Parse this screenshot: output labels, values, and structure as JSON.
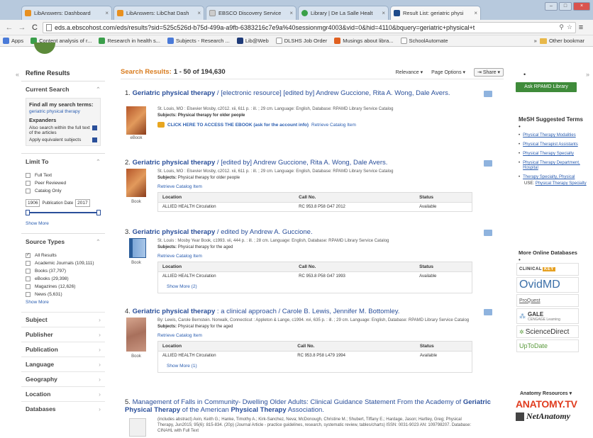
{
  "browser": {
    "tabs": [
      {
        "label": "LibAnswers: Dashboard",
        "color": "#e89020",
        "active": false
      },
      {
        "label": "LibAnswers: LibChat Dash",
        "color": "#e89020",
        "active": false
      },
      {
        "label": "EBSCO Discovery Service",
        "color": "#cccccc",
        "active": false
      },
      {
        "label": "Library | De La Salle Healt",
        "color": "#3aa048",
        "active": false
      },
      {
        "label": "Result List: geriatric physi",
        "color": "#1e4a8a",
        "active": true
      }
    ],
    "url": "eds.a.ebscohost.com/eds/results?sid=525c526d-b75d-499a-a9fb-6383216c7e9a%40sessionmgr4003&vid=0&hid=4110&bquery=geriatric+physical+t",
    "bookmarks": [
      {
        "label": "Apps",
        "color": "#4a7ad8"
      },
      {
        "label": "Content analysis of r...",
        "color": "#3a9e4a"
      },
      {
        "label": "Research in health s...",
        "color": "#3a9e4a"
      },
      {
        "label": "Subjects - Research ...",
        "color": "#4a7ad8"
      },
      {
        "label": "Lib@Web",
        "color": "#1e3a78"
      },
      {
        "label": "DLSHS Job Order",
        "color": "#cccccc"
      },
      {
        "label": "Musings about libra...",
        "color": "#e06020"
      },
      {
        "label": "SchoolAutomate",
        "color": "#cccccc"
      }
    ],
    "other_bookmarks": "Other bookmar"
  },
  "sidebar_left": {
    "refine_title": "Refine Results",
    "current_search_title": "Current Search",
    "find_all_label": "Find all my search terms:",
    "search_term": "geriatric physical therapy",
    "expanders_label": "Expanders",
    "expander_1": "Also search within the full text of the articles",
    "expander_2": "Apply equivalent subjects",
    "limit_to_title": "Limit To",
    "limits": [
      "Full Text",
      "Peer Reviewed",
      "Catalog Only"
    ],
    "date_from": "1906",
    "date_label": "Publication Date",
    "date_to": "2017",
    "show_more_1": "Show More",
    "source_types_title": "Source Types",
    "source_types": [
      {
        "label": "All Results",
        "checked": true
      },
      {
        "label": "Academic Journals (109,111)",
        "checked": false
      },
      {
        "label": "Books (37,797)",
        "checked": false
      },
      {
        "label": "eBooks (29,398)",
        "checked": false
      },
      {
        "label": "Magazines (12,626)",
        "checked": false
      },
      {
        "label": "News (5,631)",
        "checked": false
      }
    ],
    "show_more_2": "Show More",
    "facets": [
      "Subject",
      "Publisher",
      "Publication",
      "Language",
      "Geography",
      "Location",
      "Databases"
    ]
  },
  "results_header": {
    "label": "Search Results:",
    "range": "1 - 50 of 194,630",
    "relevance": "Relevance ▾",
    "page_options": "Page Options ▾",
    "share": "Share ▾"
  },
  "results": [
    {
      "num": "1.",
      "title_bold": "Geriatric physical therapy",
      "title_rest": " / [electronic resource] [edited by] Andrew Guccione, Rita A. Wong, Dale Avers.",
      "meta": "St. Louis, MO : Elsevier Mosby, c2012. xii, 611 p. : ill. ; 29 cm. Language: English, Database: RPAMD Library Service Catalog",
      "subjects_label": "Subjects:",
      "subjects": "Physical therapy for older people",
      "link_ebook": "CLICK HERE TO ACCESS THE EBOOK (ask for the account info)",
      "link_catalog": "Retrieve Catalog Item",
      "type": "eBook"
    },
    {
      "num": "2.",
      "title_bold": "Geriatric physical therapy",
      "title_rest": " / [edited by] Andrew Guccione, Rita A. Wong, Dale Avers.",
      "meta": "St. Louis, MO : Elsevier Mosby, c2012. xii, 611 p. : ill. ; 29 cm. Language: English, Database: RPAMD Library Service Catalog",
      "subjects_label": "Subjects:",
      "subjects": "Physical therapy for older people",
      "link_catalog": "Retrieve Catalog Item",
      "type": "Book",
      "holdings_headers": [
        "Location",
        "Call No.",
        "Status"
      ],
      "holdings": [
        [
          "ALLIED HEALTH Circulation",
          "RC 953.8 P58 G47 2012",
          "Available"
        ]
      ]
    },
    {
      "num": "3.",
      "title_bold": "Geriatric physical therapy",
      "title_rest": " / edited by Andrew A. Guccione.",
      "meta": "St. Louis : Mosby Year Book, c1993. vii, 444 p. : ill. ; 28 cm. Language: English, Database: RPAMD Library Service Catalog",
      "subjects_label": "Subjects:",
      "subjects": "Physical therapy for the aged",
      "link_catalog": "Retrieve Catalog Item",
      "type": "Book",
      "holdings_headers": [
        "Location",
        "Call No.",
        "Status"
      ],
      "holdings": [
        [
          "ALLIED HEALTH Circulation",
          "RC 953.8 P58 G47 1993",
          "Available"
        ]
      ],
      "show_more": "Show More (2)"
    },
    {
      "num": "4.",
      "title_bold": "Geriatric physical therapy",
      "title_rest": " : a clinical approach / Carole B. Lewis, Jennifer M. Bottomley.",
      "meta": "By: Lewis, Carole Bernstein. Norwalk, Connecticut : Appleton & Lange, c1994. xvi, 635 p. : ill. ; 29 cm. Language: English, Database: RPAMD Library Service Catalog",
      "subjects_label": "Subjects:",
      "subjects": "Physical therapy for the aged",
      "link_catalog": "Retrieve Catalog Item",
      "type": "Book",
      "holdings_headers": [
        "Location",
        "Call No.",
        "Status"
      ],
      "holdings": [
        [
          "ALLIED HEALTH Circulation",
          "RC 953.8 P58 L479 1994",
          "Available"
        ]
      ],
      "show_more": "Show More (1)"
    },
    {
      "num": "5.",
      "title_a": "Management of Falls in Community- Dwelling Older Adults: Clinical Guidance Statement From the Academy of ",
      "title_b1": "Geriatric Physical Therapy",
      "title_c": " of the American ",
      "title_b2": "Physical Therapy",
      "title_d": " Association.",
      "meta": "(includes abstract) Avin, Keith G.; Hanke, Timothy A.; Kirk-Sanchez, Neva; McDonough, Christine M.; Shubert, Tiffany E.; Hardage, Jason; Hartley, Greg; Physical Therapy, Jun2015; 95(6): 815-834. (20p) (Journal Article - practice guidelines, research, systematic review, tables/charts) ISSN: 0031-9023 AN: 109798207. Database: CINAHL with Full Text"
    }
  ],
  "sidebar_right": {
    "ask_button": "Ask RPAMD Library",
    "mesh_title": "MeSH Suggested Terms",
    "mesh_terms": [
      "Physical Therapy Modalities",
      "Physical Therapist Assistants",
      "Physical Therapy Specialty",
      "Physical Therapy Department, Hospital",
      "Therapy Specialty, Physical"
    ],
    "use_label": "USE:",
    "use_term": "Physical Therapy Specialty",
    "more_db_title": "More Online Databases",
    "databases": {
      "clinical_a": "CLINICAL",
      "clinical_b": "KEY",
      "ovid": "OvidMD",
      "proquest": "ProQuest",
      "gale": "GALE",
      "gale_sub": "CENGAGE Learning",
      "sd": "ScienceDirect",
      "utd": "UpToDate"
    },
    "anatomy_title": "Anatomy Resources ▾",
    "anatomy_tv": "ANATOMY.TV",
    "netanatomy": "NetAnatomy"
  }
}
